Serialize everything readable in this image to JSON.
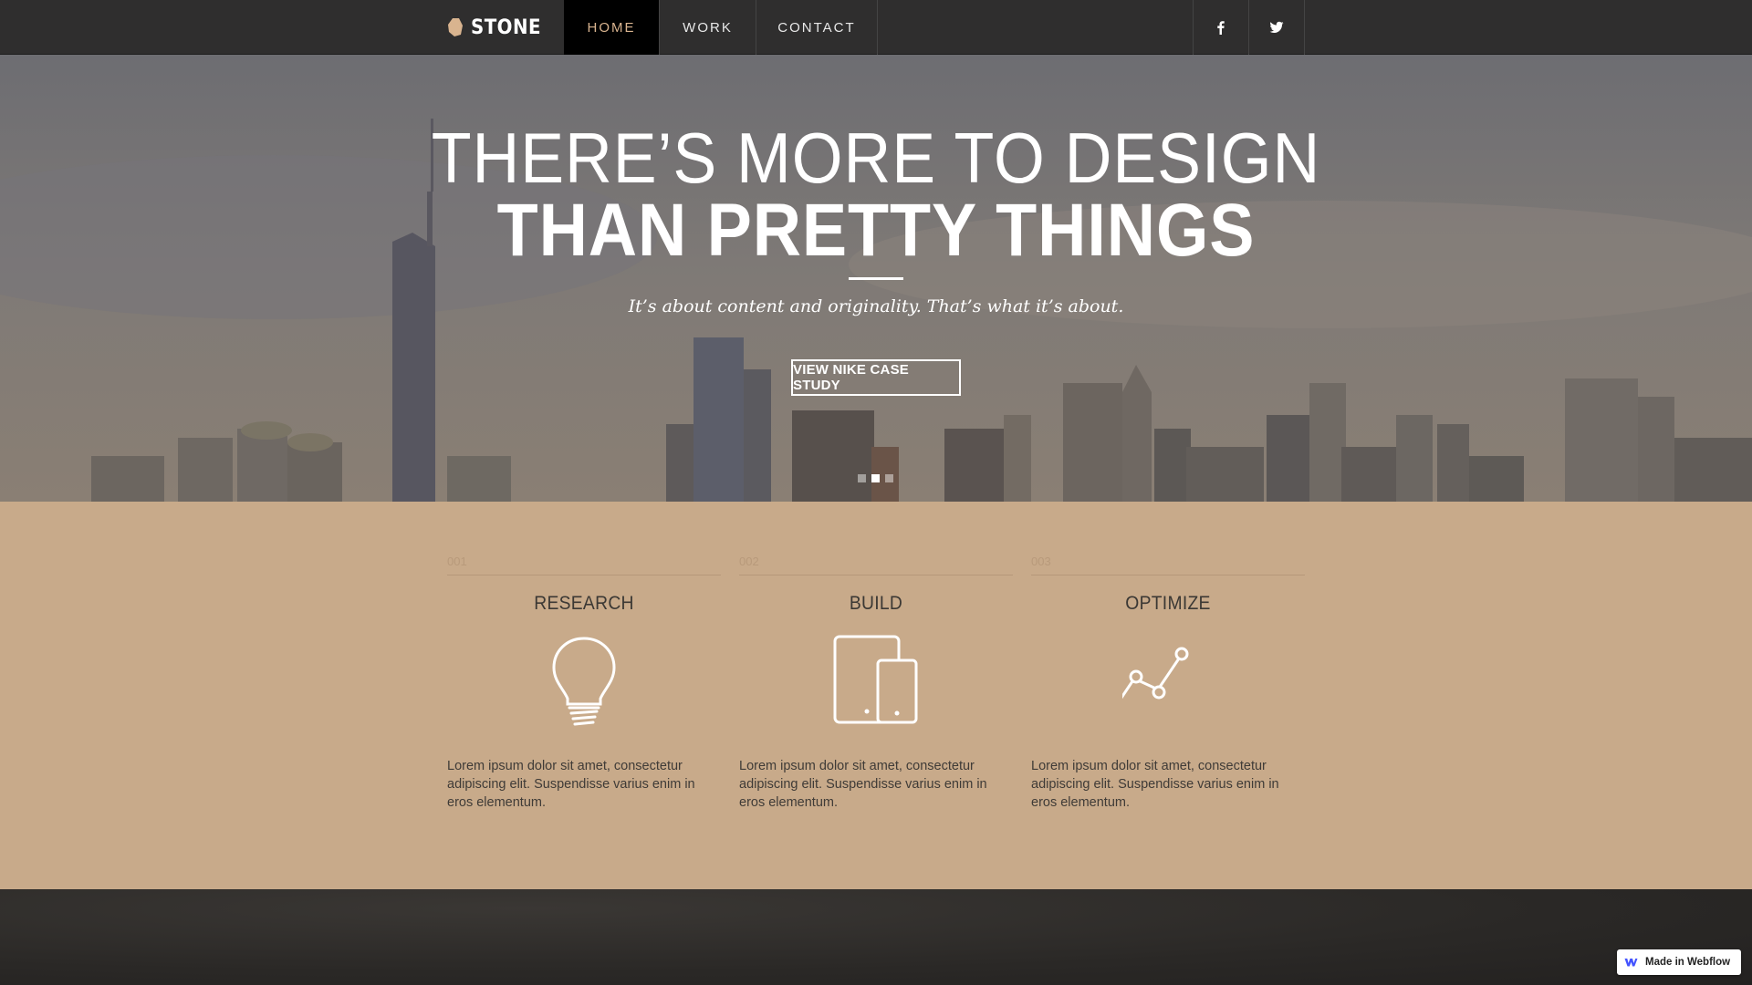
{
  "nav": {
    "brand": "STONE",
    "links": [
      {
        "label": "HOME",
        "active": true
      },
      {
        "label": "WORK",
        "active": false
      },
      {
        "label": "CONTACT",
        "active": false
      }
    ],
    "social": [
      {
        "name": "facebook-icon",
        "glyph": "f"
      },
      {
        "name": "twitter-icon",
        "glyph": "twitter"
      }
    ]
  },
  "hero": {
    "title_line1": "THERE’S MORE TO DESIGN",
    "title_line2": "THAN PRETTY THINGS",
    "subtitle": "It’s about content and originality. That’s what it’s about.",
    "button": "VIEW NIKE CASE STUDY",
    "slides": 3,
    "active_slide": 2
  },
  "features": [
    {
      "number": "001",
      "title": "RESEARCH",
      "icon": "lightbulb-icon",
      "text": "Lorem ipsum dolor sit amet, consectetur adipiscing elit. Suspendisse varius enim in eros elementum."
    },
    {
      "number": "002",
      "title": "BUILD",
      "icon": "devices-icon",
      "text": "Lorem ipsum dolor sit amet, consectetur adipiscing elit. Suspendisse varius enim in eros elementum."
    },
    {
      "number": "003",
      "title": "OPTIMIZE",
      "icon": "line-graph-icon",
      "text": "Lorem ipsum dolor sit amet, consectetur adipiscing elit. Suspendisse varius enim in eros elementum."
    }
  ],
  "badge": {
    "label": "Made in Webflow"
  },
  "colors": {
    "nav_bg": "#2f2e2e",
    "active_link": "#d9b48f",
    "features_bg": "#c8aa8a",
    "bottom_bg": "#2a2826"
  }
}
